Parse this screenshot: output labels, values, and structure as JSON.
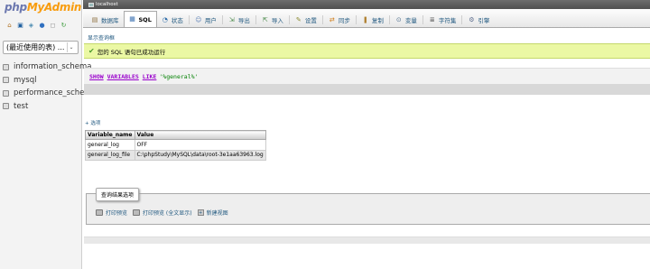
{
  "sidebar": {
    "logo_php": "php",
    "logo_my": "MyAdmin",
    "db_select_value": "(最近使用的表) ...",
    "databases": [
      {
        "label": "information_schema"
      },
      {
        "label": "mysql"
      },
      {
        "label": "performance_schema"
      },
      {
        "label": "test"
      }
    ]
  },
  "topbar": {
    "server": "localhost"
  },
  "tabs": [
    {
      "label": "数据库",
      "icon": "▤",
      "color": "#8a6d3b"
    },
    {
      "label": "SQL",
      "icon": "▦",
      "color": "#3a70b0"
    },
    {
      "label": "状态",
      "icon": "◔",
      "color": "#2b6aa8"
    },
    {
      "label": "用户",
      "icon": "☺",
      "color": "#5a7fb5"
    },
    {
      "label": "导出",
      "icon": "⇲",
      "color": "#4a8a4a"
    },
    {
      "label": "导入",
      "icon": "⇱",
      "color": "#4a8a4a"
    },
    {
      "label": "设置",
      "icon": "✎",
      "color": "#8a8a30"
    },
    {
      "label": "同步",
      "icon": "⇄",
      "color": "#d08020"
    },
    {
      "label": "复制",
      "icon": "❚",
      "color": "#b08030"
    },
    {
      "label": "变量",
      "icon": "⊙",
      "color": "#507090"
    },
    {
      "label": "字符集",
      "icon": "≣",
      "color": "#606060"
    },
    {
      "label": "引擎",
      "icon": "⚙",
      "color": "#607090"
    }
  ],
  "active_tab": 1,
  "main": {
    "show_query_link": "显示查询框",
    "success_message": "您的 SQL 语句已成功运行",
    "sql": {
      "kw1": "SHOW",
      "kw2": "VARIABLES",
      "kw3": "LIKE",
      "str": "'%general%'"
    },
    "options_link": "+ 选项",
    "results": {
      "headers": [
        "Variable_name",
        "Value"
      ],
      "rows": [
        [
          "general_log",
          "OFF"
        ],
        [
          "general_log_file",
          "C:\\phpStudy\\MySQL\\data\\root-3e1aa63963.log"
        ]
      ]
    },
    "ops": {
      "legend": "查询结果选项",
      "print_view": "打印预览",
      "print_view_full": "打印预览 (全文显示)",
      "create_view": "新建视图"
    }
  },
  "colors": {
    "success_bg": "#ebf8a4",
    "link": "#235a81",
    "topbar": "#5a5a5a"
  }
}
